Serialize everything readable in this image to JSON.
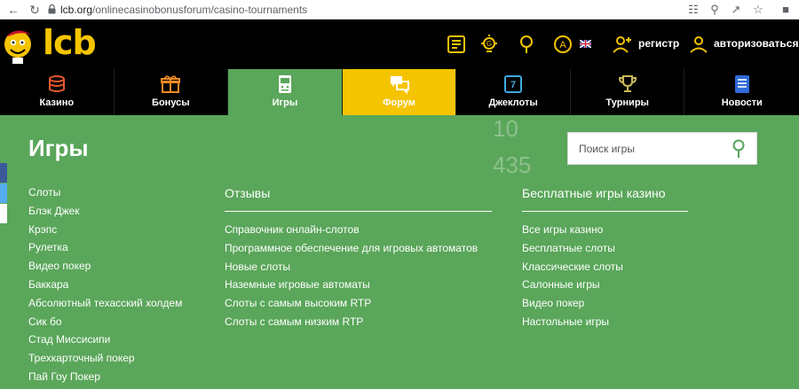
{
  "browser": {
    "url_host": "lcb.org",
    "url_path": "/onlinecasinobonusforum/casino-tournaments"
  },
  "header": {
    "logo_text": "lcb",
    "register_label": "регистр",
    "login_label": "авторизоваться",
    "accent_color": "#f5c400"
  },
  "categories": [
    {
      "label": "Казино",
      "icon": "casino-chips-icon"
    },
    {
      "label": "Бонусы",
      "icon": "gift-icon"
    },
    {
      "label": "Игры",
      "icon": "slot-machine-icon"
    },
    {
      "label": "Форум",
      "icon": "chat-bubbles-icon"
    },
    {
      "label": "Джеклоты",
      "icon": "jackpot-icon"
    },
    {
      "label": "Турниры",
      "icon": "trophy-icon"
    },
    {
      "label": "Новости",
      "icon": "newspaper-icon"
    }
  ],
  "main": {
    "title": "Игры",
    "overlay_numbers": [
      "10",
      "435"
    ],
    "search_placeholder": "Поиск игры",
    "games": [
      "Слоты",
      "Блэк Джек",
      "Крэпс",
      "Рулетка",
      "Видео покер",
      "Баккара",
      "Абсолютный техасский холдем",
      "Сик бо",
      "Стад Миссисипи",
      "Трехкарточный покер",
      "Пай Гоу Покер"
    ],
    "reviews": {
      "heading": "Отзывы",
      "items": [
        "Справочник онлайн-слотов",
        "Программное обеспечение для игровых автоматов",
        "Новые слоты",
        "Наземные игровые автоматы",
        "Слоты с самым высоким RTP",
        "Слоты с самым низким RTP"
      ]
    },
    "free_games": {
      "heading": "Бесплатные игры казино",
      "items": [
        "Все игры казино",
        "Бесплатные слоты",
        "Классические слоты",
        "Салонные игры",
        "Видео покер",
        "Настольные игры"
      ]
    }
  },
  "colors": {
    "green": "#5aa65a",
    "yellow": "#f5c400",
    "black": "#000000"
  }
}
